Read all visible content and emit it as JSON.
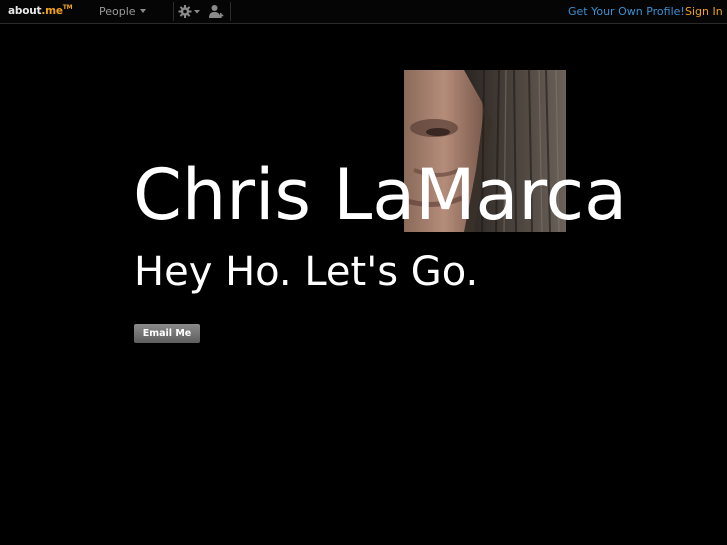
{
  "topbar": {
    "logo_text": "about",
    "logo_me": ".me",
    "logo_tm": "TM",
    "people_label": "People",
    "settings_icon": "gear-icon",
    "add_user_icon": "add-user-icon",
    "get_profile_label": "Get Your Own Profile!",
    "sign_in_label": "Sign In"
  },
  "profile": {
    "name": "Chris LaMarca",
    "headline": "Hey Ho. Let's Go.",
    "email_button_label": "Email Me"
  },
  "colors": {
    "background": "#000000",
    "accent_orange": "#f0a21c",
    "link_blue": "#3c8fd0"
  }
}
